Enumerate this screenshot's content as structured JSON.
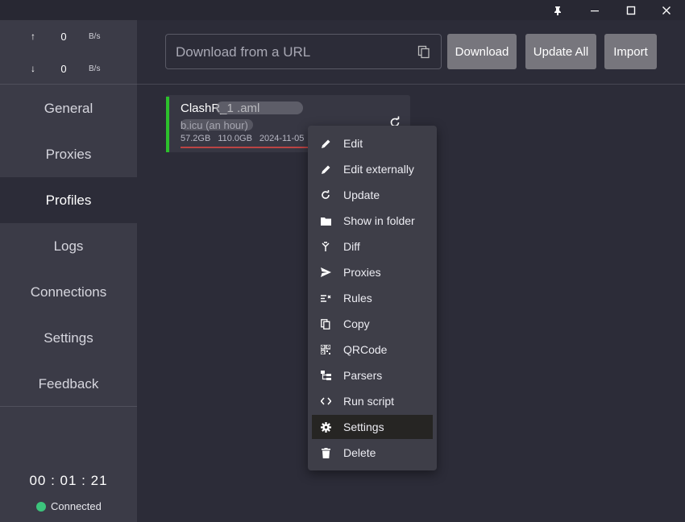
{
  "window": {
    "pin_icon": "pin-icon",
    "minimize_icon": "minimize-icon",
    "maximize_icon": "maximize-icon",
    "close_icon": "close-icon"
  },
  "traffic": {
    "up": {
      "arrow": "↑",
      "value": "0",
      "unit": "B/s"
    },
    "down": {
      "arrow": "↓",
      "value": "0",
      "unit": "B/s"
    }
  },
  "nav": [
    {
      "label": "General"
    },
    {
      "label": "Proxies"
    },
    {
      "label": "Profiles",
      "active": true
    },
    {
      "label": "Logs"
    },
    {
      "label": "Connections"
    },
    {
      "label": "Settings"
    },
    {
      "label": "Feedback"
    }
  ],
  "footer": {
    "timer": "00 : 01 : 21",
    "status": "Connected",
    "status_color": "#3cc47c"
  },
  "url_bar": {
    "placeholder": "Download from a URL",
    "value": ""
  },
  "buttons": {
    "download": "Download",
    "update_all": "Update All",
    "import": "Import"
  },
  "profile": {
    "name": "ClashR_1                      .aml",
    "host": "                     b.icu (an hour)",
    "used": "57.2GB",
    "total": "110.0GB",
    "date": "2024-11-05",
    "accent": "#2cc02c"
  },
  "context_menu": [
    {
      "label": "Edit",
      "icon": "pencil-icon"
    },
    {
      "label": "Edit externally",
      "icon": "pencil-icon"
    },
    {
      "label": "Update",
      "icon": "refresh-icon"
    },
    {
      "label": "Show in folder",
      "icon": "folder-icon"
    },
    {
      "label": "Diff",
      "icon": "merge-icon"
    },
    {
      "label": "Proxies",
      "icon": "send-icon"
    },
    {
      "label": "Rules",
      "icon": "rules-icon"
    },
    {
      "label": "Copy",
      "icon": "copy-icon"
    },
    {
      "label": "QRCode",
      "icon": "qrcode-icon"
    },
    {
      "label": "Parsers",
      "icon": "tree-icon"
    },
    {
      "label": "Run script",
      "icon": "code-icon"
    },
    {
      "label": "Settings",
      "icon": "gear-icon",
      "highlighted": true
    },
    {
      "label": "Delete",
      "icon": "trash-icon"
    }
  ]
}
